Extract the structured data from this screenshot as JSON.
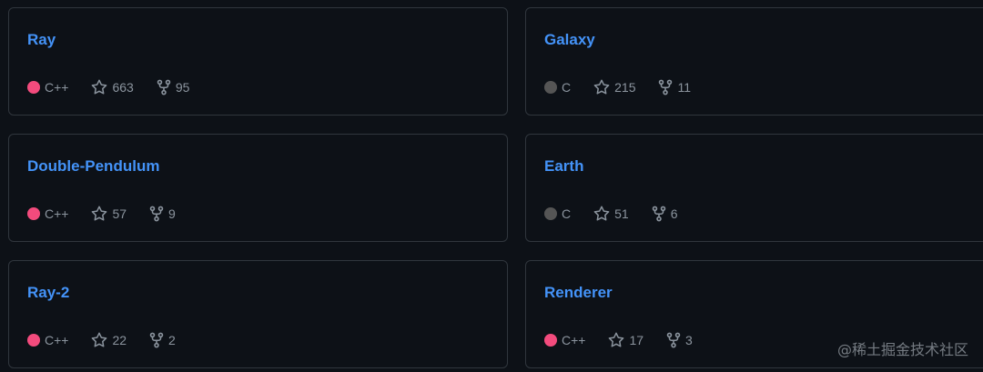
{
  "repos": [
    {
      "name": "Ray",
      "language": "C++",
      "language_color": "#f34b7d",
      "stars": "663",
      "forks": "95"
    },
    {
      "name": "Galaxy",
      "language": "C",
      "language_color": "#555555",
      "stars": "215",
      "forks": "11"
    },
    {
      "name": "Double-Pendulum",
      "language": "C++",
      "language_color": "#f34b7d",
      "stars": "57",
      "forks": "9"
    },
    {
      "name": "Earth",
      "language": "C",
      "language_color": "#555555",
      "stars": "51",
      "forks": "6"
    },
    {
      "name": "Ray-2",
      "language": "C++",
      "language_color": "#f34b7d",
      "stars": "22",
      "forks": "2"
    },
    {
      "name": "Renderer",
      "language": "C++",
      "language_color": "#f34b7d",
      "stars": "17",
      "forks": "3"
    }
  ],
  "watermark": "@稀土掘金技术社区",
  "icons": {
    "star": "star-icon",
    "fork": "fork-icon"
  },
  "colors": {
    "link": "#4493f8",
    "muted": "#8b949e",
    "border": "#30363d",
    "background": "#0d1117"
  }
}
